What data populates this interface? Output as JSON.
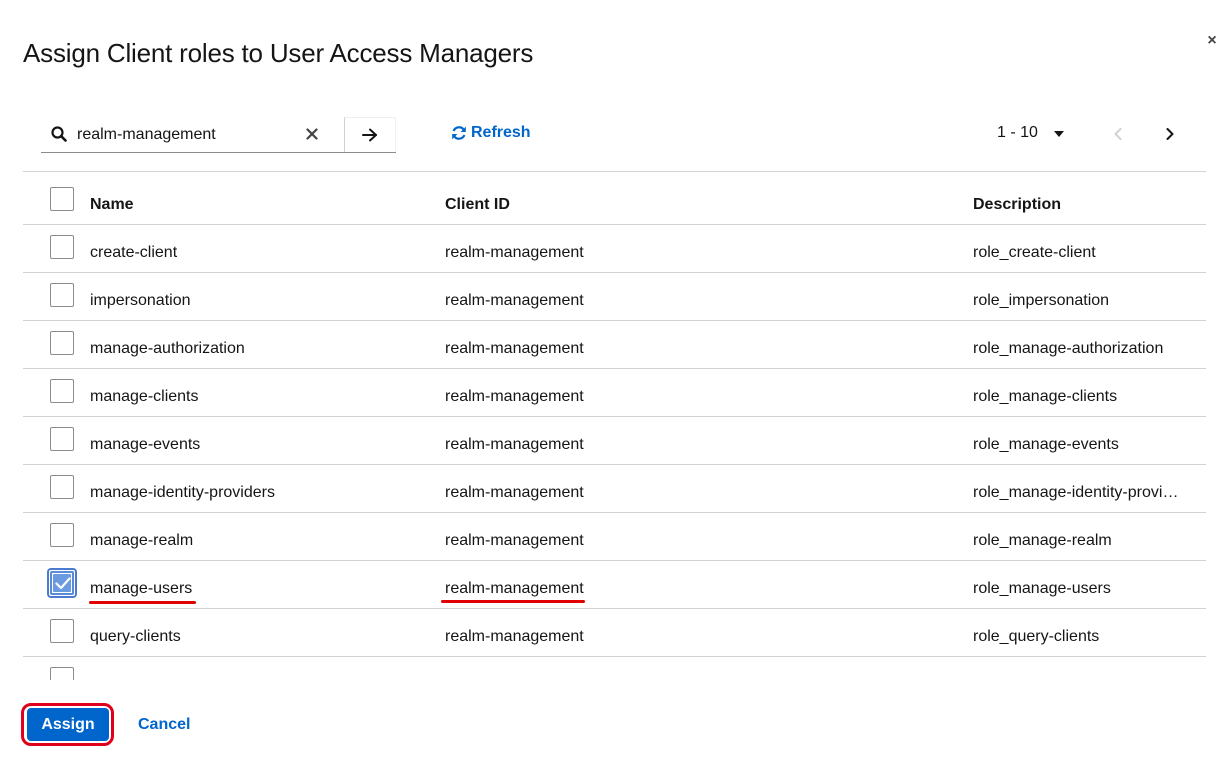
{
  "modal": {
    "title": "Assign Client roles to User Access Managers",
    "close_label": "×"
  },
  "search": {
    "value": "realm-management",
    "placeholder": "Search"
  },
  "toolbar": {
    "refresh_label": "Refresh",
    "pagination_label": "1 - 10"
  },
  "table": {
    "columns": [
      "Name",
      "Client ID",
      "Description"
    ],
    "rows": [
      {
        "name": "create-client",
        "client_id": "realm-management",
        "description": "role_create-client",
        "checked": false
      },
      {
        "name": "impersonation",
        "client_id": "realm-management",
        "description": "role_impersonation",
        "checked": false
      },
      {
        "name": "manage-authorization",
        "client_id": "realm-management",
        "description": "role_manage-authorization",
        "checked": false
      },
      {
        "name": "manage-clients",
        "client_id": "realm-management",
        "description": "role_manage-clients",
        "checked": false
      },
      {
        "name": "manage-events",
        "client_id": "realm-management",
        "description": "role_manage-events",
        "checked": false
      },
      {
        "name": "manage-identity-providers",
        "client_id": "realm-management",
        "description": "role_manage-identity-providers",
        "checked": false
      },
      {
        "name": "manage-realm",
        "client_id": "realm-management",
        "description": "role_manage-realm",
        "checked": false
      },
      {
        "name": "manage-users",
        "client_id": "realm-management",
        "description": "role_manage-users",
        "checked": true
      },
      {
        "name": "query-clients",
        "client_id": "realm-management",
        "description": "role_query-clients",
        "checked": false
      },
      {
        "name": "",
        "client_id": "",
        "description": "",
        "checked": false
      }
    ]
  },
  "footer": {
    "assign_label": "Assign",
    "cancel_label": "Cancel"
  },
  "colors": {
    "primary": "#0066cc",
    "annotation_red": "#e00000"
  }
}
